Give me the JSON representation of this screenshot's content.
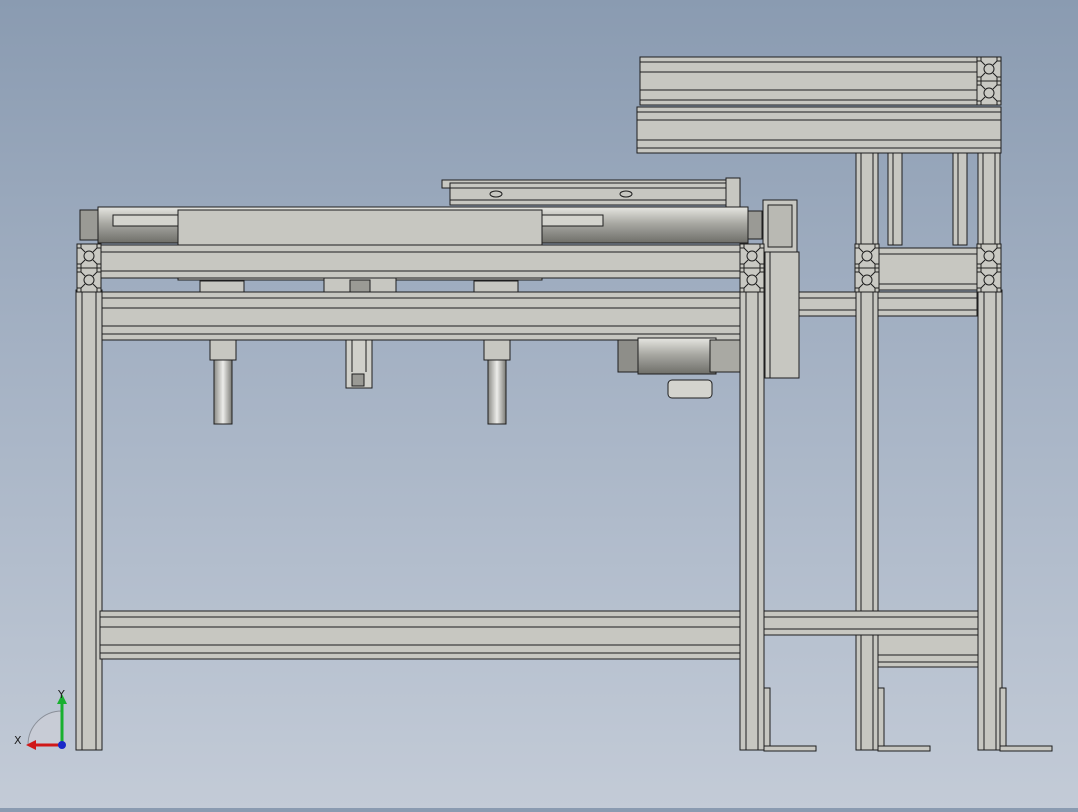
{
  "viewport": {
    "background_top": "#8a9bb1",
    "background_bottom": "#c3cbd7",
    "model_fill": "#c7c7c1",
    "model_edge": "#1e1e1e"
  },
  "triad": {
    "x_label": "X",
    "y_label": "Y",
    "x_color": "#d01818",
    "y_color": "#18b030",
    "z_color": "#1828c8"
  }
}
